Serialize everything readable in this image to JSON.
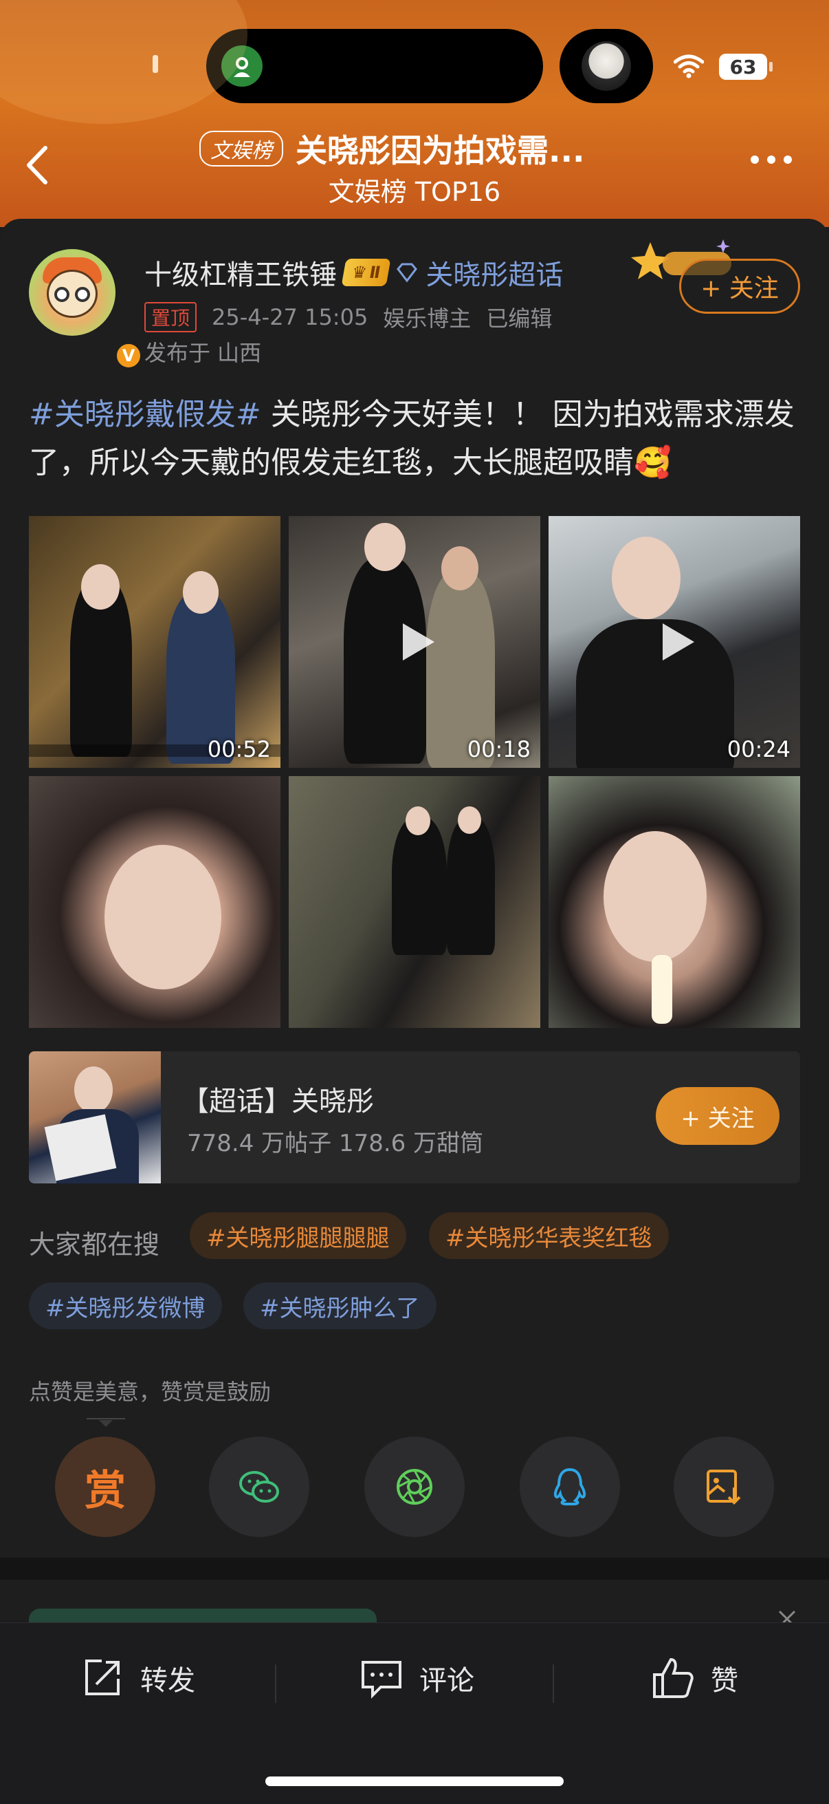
{
  "status": {
    "battery": "63"
  },
  "header": {
    "list_tag": "文娱榜",
    "title": "关晓彤因为拍戏需...",
    "subtitle": "文娱榜 TOP16"
  },
  "post": {
    "username": "十级杠精王铁锤",
    "level": "Ⅱ",
    "super_topic": "关晓彤超话",
    "follow_label": "+ 关注",
    "pinned": "置顶",
    "datetime": "25-4-27 15:05",
    "role": "娱乐博主",
    "edited": "已编辑",
    "location": "发布于 山西",
    "hashtag": "#关晓彤戴假发#",
    "text": " 关晓彤今天好美！！ 因为拍戏需求漂发了，所以今天戴的假发走红毯，大长腿超吸睛🥰",
    "media": [
      {
        "type": "video",
        "duration": "00:52"
      },
      {
        "type": "video",
        "duration": "00:18"
      },
      {
        "type": "video",
        "duration": "00:24"
      },
      {
        "type": "image"
      },
      {
        "type": "image"
      },
      {
        "type": "image"
      }
    ]
  },
  "topic_card": {
    "name": "【超话】关晓彤",
    "stats": "778.4 万帖子 178.6 万甜筒",
    "follow_label": "+ 关注"
  },
  "searches": {
    "label": "大家都在搜",
    "chips": [
      "#关晓彤腿腿腿腿",
      "#关晓彤华表奖红毯",
      "#关晓彤发微博",
      "#关晓彤肿么了"
    ]
  },
  "reward": {
    "hint": "点赞是美意，赞赏是鼓励",
    "reward_glyph": "赏",
    "buttons": [
      "reward-icon",
      "wechat-icon",
      "moments-icon",
      "qq-icon",
      "save-image-icon"
    ]
  },
  "bottom_bar": {
    "repost": "转发",
    "comment": "评论",
    "like": "赞"
  },
  "colors": {
    "accent_orange": "#e8893a",
    "link_blue": "#7e9edb",
    "header_orange": "#d8731f"
  }
}
